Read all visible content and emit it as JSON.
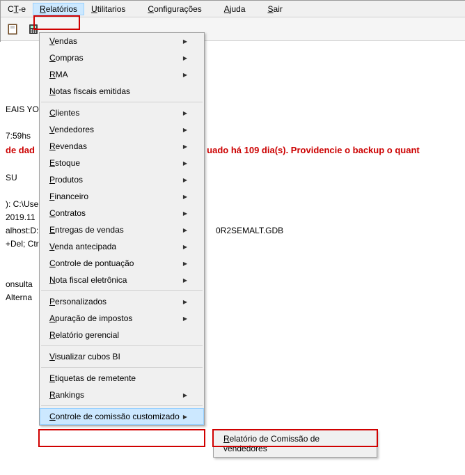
{
  "menubar": {
    "items": [
      {
        "label": "CT-e",
        "ul": "T"
      },
      {
        "label": "Relatórios",
        "ul": "R",
        "active": true
      },
      {
        "label": "Utilitarios",
        "ul": "U"
      },
      {
        "label": "Configurações",
        "ul": "C"
      },
      {
        "label": "Ajuda",
        "ul": "A"
      },
      {
        "label": "Sair",
        "ul": "S"
      }
    ]
  },
  "dropdown": {
    "items": [
      {
        "label": "Vendas",
        "ul": "V",
        "arrow": true
      },
      {
        "label": "Compras",
        "ul": "C",
        "arrow": true
      },
      {
        "label": "RMA",
        "ul": "R",
        "arrow": true
      },
      {
        "label": "Notas fiscais emitidas",
        "ul": "N"
      },
      {
        "sep": true
      },
      {
        "label": "Clientes",
        "ul": "C",
        "arrow": true
      },
      {
        "label": "Vendedores",
        "ul": "V",
        "arrow": true
      },
      {
        "label": "Revendas",
        "ul": "R",
        "arrow": true
      },
      {
        "label": "Estoque",
        "ul": "E",
        "arrow": true
      },
      {
        "label": "Produtos",
        "ul": "P",
        "arrow": true
      },
      {
        "label": "Financeiro",
        "ul": "F",
        "arrow": true
      },
      {
        "label": "Contratos",
        "ul": "C",
        "arrow": true
      },
      {
        "label": "Entregas de vendas",
        "ul": "E",
        "arrow": true
      },
      {
        "label": "Venda antecipada",
        "ul": "V",
        "arrow": true
      },
      {
        "label": "Controle de pontuação",
        "ul": "C",
        "arrow": true
      },
      {
        "label": "Nota fiscal eletrônica",
        "ul": "N",
        "arrow": true
      },
      {
        "sep": true
      },
      {
        "label": "Personalizados",
        "ul": "P",
        "arrow": true
      },
      {
        "label": "Apuração de impostos",
        "ul": "A",
        "arrow": true
      },
      {
        "label": "Relatório gerencial",
        "ul": "R"
      },
      {
        "sep": true
      },
      {
        "label": "Visualizar cubos BI",
        "ul": "V"
      },
      {
        "sep": true
      },
      {
        "label": "Etiquetas de remetente",
        "ul": "E"
      },
      {
        "label": "Rankings",
        "ul": "R",
        "arrow": true
      },
      {
        "sep": true
      },
      {
        "label": "Controle de comissão customizado",
        "ul": "C",
        "arrow": true,
        "highlighted": true
      }
    ]
  },
  "submenu": {
    "label": "Relatório de Comissão de vendedores",
    "ul": "R"
  },
  "content": {
    "l1": "EAIS YOK",
    "l2": "7:59hs",
    "warn_prefix": "de dad",
    "warn_suffix": "uado há 109 dia(s). Providencie o backup o quant",
    "l3": "SU",
    "l4": "): C:\\Use",
    "l5": "2019.11",
    "l6": "alhost:D:",
    "l6b": "0R2SEMALT.GDB",
    "l7": "+Del; Ctr",
    "l8": "onsulta",
    "l9": "Alterna"
  }
}
